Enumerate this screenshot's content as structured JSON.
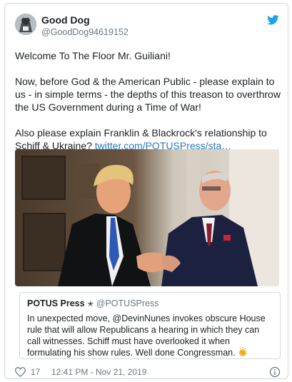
{
  "author": {
    "display_name": "Good Dog",
    "handle": "@GoodDog94619152",
    "avatar_icon": "dog-avatar"
  },
  "brand": {
    "icon": "twitter-bird-icon",
    "color": "#1da1f2"
  },
  "tweet": {
    "paragraph_1": "Welcome To The Floor Mr. Guiliani!",
    "paragraph_2": "Now, before God & the American Public - please explain to us - in simple terms - the depths of this treason to overthrow the US Government during a Time of War!",
    "paragraph_3_text": "Also please explain Franklin & Blackrock's relationship to Schiff & Ukraine?",
    "paragraph_3_link": "twitter.com/POTUSPress/sta…",
    "link_color": "#2b7bb9"
  },
  "quoted_tweet": {
    "name": "POTUS Press",
    "badge": "✭",
    "handle": "@POTUSPress",
    "body": "In unexpected move, @DevinNunes invokes obscure House rule that will allow Republicans a hearing in which they can call witnesses. Schiff must have overlooked it when formulating his show rules. Well done Congressman.",
    "emoji": "clapping-hands"
  },
  "footer": {
    "likes": "17",
    "timestamp": "12:41 PM - Nov 21, 2019",
    "heart_icon": "heart-icon",
    "info_icon": "info-icon"
  }
}
